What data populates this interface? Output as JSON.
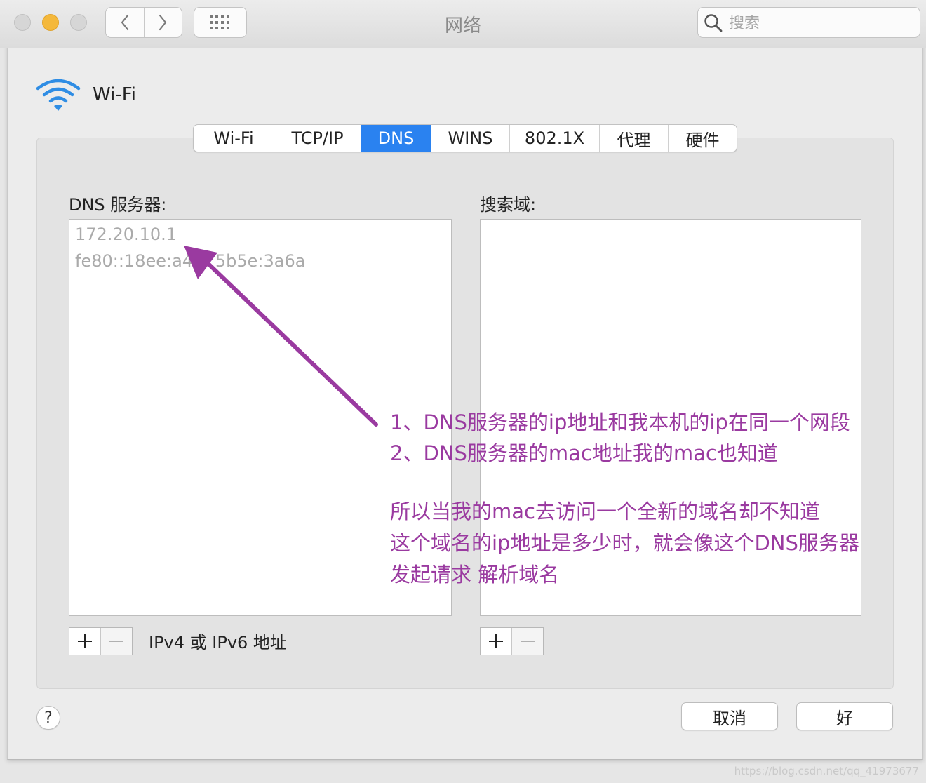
{
  "window": {
    "title": "网络"
  },
  "toolbar": {
    "search_placeholder": "搜索"
  },
  "header": {
    "interface_name": "Wi-Fi"
  },
  "tabs": [
    {
      "label": "Wi-Fi",
      "active": false
    },
    {
      "label": "TCP/IP",
      "active": false
    },
    {
      "label": "DNS",
      "active": true
    },
    {
      "label": "WINS",
      "active": false
    },
    {
      "label": "802.1X",
      "active": false
    },
    {
      "label": "代理",
      "active": false
    },
    {
      "label": "硬件",
      "active": false
    }
  ],
  "dns": {
    "servers_label": "DNS 服务器:",
    "servers": [
      "172.20.10.1",
      "fe80::18ee:a4f5:5b5e:3a6a"
    ],
    "hint": "IPv4 或 IPv6 地址"
  },
  "search_domains": {
    "label": "搜索域:",
    "items": []
  },
  "controls": {
    "add": "+",
    "remove": "—"
  },
  "footer": {
    "help": "?",
    "cancel": "取消",
    "ok": "好"
  },
  "annotation": {
    "color": "#9a3aa0",
    "lines": [
      "1、DNS服务器的ip地址和我本机的ip在同一个网段",
      "2、DNS服务器的mac地址我的mac也知道",
      "所以当我的mac去访问一个全新的域名却不知道",
      "这个域名的ip地址是多少时，就会像这个DNS服务器",
      "发起请求 解析域名"
    ]
  },
  "watermark": "https://blog.csdn.net/qq_41973677",
  "colors": {
    "accent": "#2a82f0",
    "minimize": "#f4b83b"
  }
}
